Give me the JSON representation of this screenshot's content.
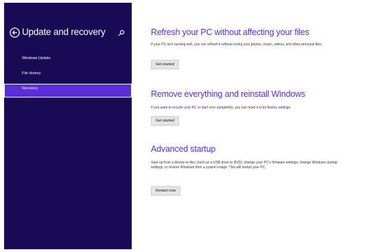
{
  "sidebar": {
    "title": "Update and recovery",
    "back_icon": "back-arrow-icon",
    "search_icon": "search-icon",
    "items": [
      {
        "label": "Windows Update",
        "selected": false
      },
      {
        "label": "File History",
        "selected": false
      },
      {
        "label": "Recovery",
        "selected": true
      }
    ]
  },
  "main": {
    "sections": [
      {
        "title": "Refresh your PC without affecting your files",
        "description": "If your PC isn't running well, you can refresh it without losing your photos, music, videos, and other personal files.",
        "button": "Get started"
      },
      {
        "title": "Remove everything and reinstall Windows",
        "description": "If you want to recycle your PC or start over completely, you can reset it to its factory settings.",
        "button": "Get started"
      },
      {
        "title": "Advanced startup",
        "description": "Start up from a device or disc (such as a USB drive or DVD), change your PC's firmware settings, change Windows startup settings, or restore Windows from a system image. This will restart your PC.",
        "button": "Restart now"
      }
    ]
  },
  "colors": {
    "sidebar_bg": "#180a55",
    "accent": "#5b2ed9",
    "selected_bg": "#5b2ed9"
  }
}
